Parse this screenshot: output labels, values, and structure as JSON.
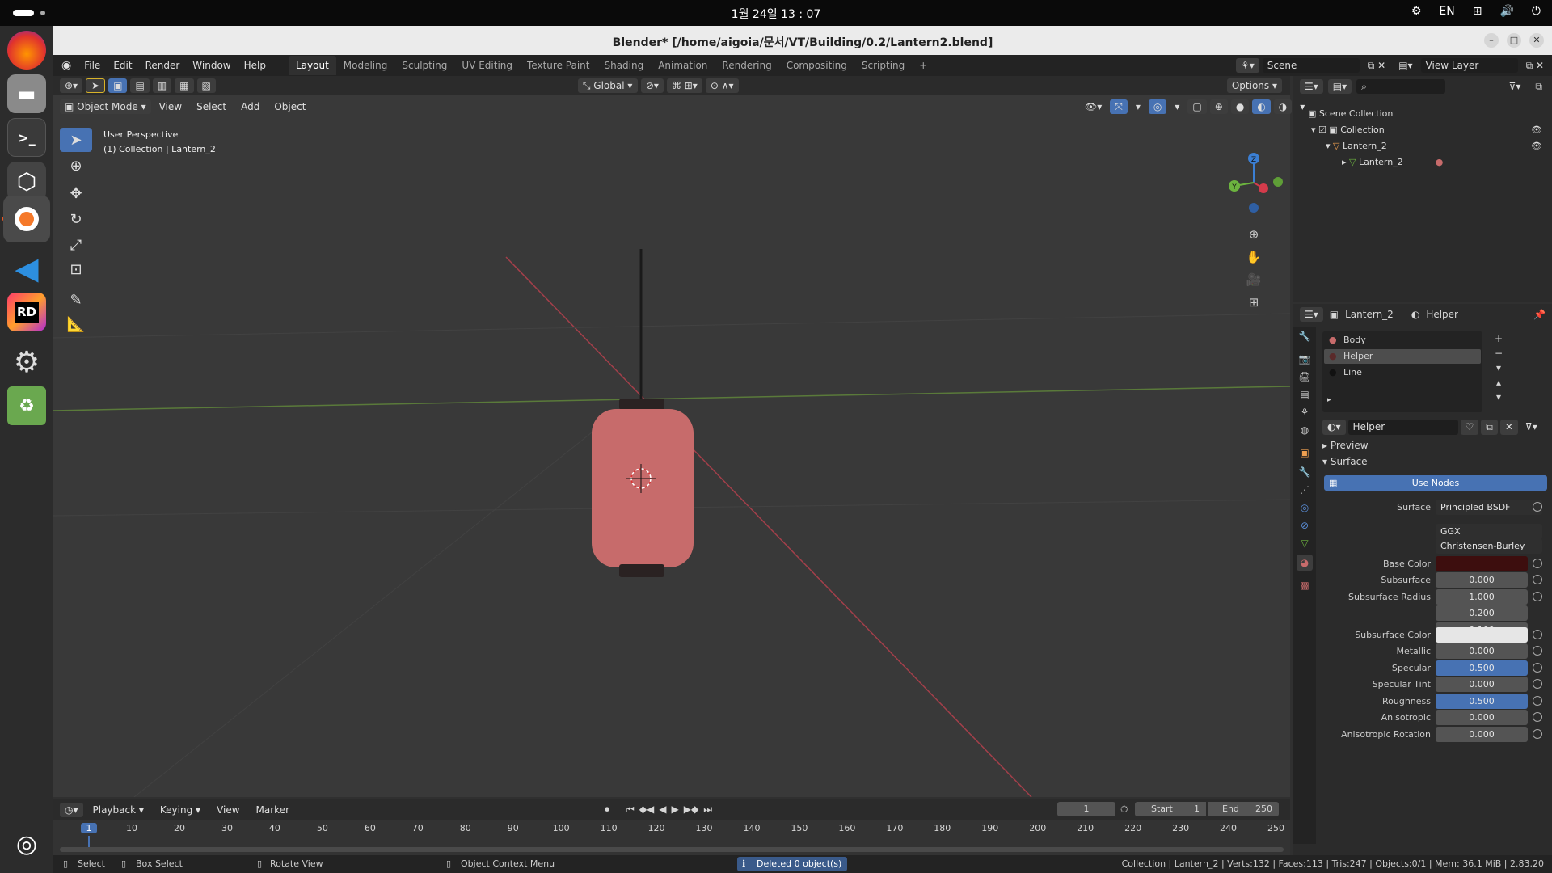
{
  "system": {
    "clock": "1월 24일  13 : 07",
    "lang": "EN"
  },
  "window": {
    "title": "Blender* [/home/aigoia/문서/VT/Building/0.2/Lantern2.blend]"
  },
  "menu": [
    "File",
    "Edit",
    "Render",
    "Window",
    "Help"
  ],
  "workspaces": [
    "Layout",
    "Modeling",
    "Sculpting",
    "UV Editing",
    "Texture Paint",
    "Shading",
    "Animation",
    "Rendering",
    "Compositing",
    "Scripting"
  ],
  "scene": {
    "label": "Scene",
    "view_layer": "View Layer"
  },
  "viewport": {
    "transform": "Global",
    "options": "Options",
    "mode": "Object Mode",
    "menus": [
      "View",
      "Select",
      "Add",
      "Object"
    ],
    "overlay_title": "User Perspective",
    "overlay_sub": "(1) Collection | Lantern_2",
    "gizmo": {
      "x": "X",
      "y": "Y",
      "z": "Z"
    }
  },
  "outliner": {
    "scene_collection": "Scene Collection",
    "collection": "Collection",
    "object": "Lantern_2",
    "mesh": "Lantern_2"
  },
  "properties": {
    "object": "Lantern_2",
    "material": "Helper",
    "slots": [
      "Body",
      "Helper",
      "Line"
    ],
    "active_slot": 1,
    "material_name": "Helper",
    "preview": "Preview",
    "surface_panel": "Surface",
    "use_nodes": "Use Nodes",
    "surface_label": "Surface",
    "surface_value": "Principled BSDF",
    "distribution": "GGX",
    "subsurface_method": "Christensen-Burley",
    "base_color_label": "Base Color",
    "base_color": "#3d0e0e",
    "rows": [
      {
        "label": "Subsurface",
        "value": "0.000",
        "blue": false
      },
      {
        "label": "Subsurface Radius",
        "value": "1.000",
        "blue": false
      },
      {
        "label": "",
        "value": "0.200",
        "blue": false
      },
      {
        "label": "",
        "value": "0.100",
        "blue": false
      }
    ],
    "subsurface_color_label": "Subsurface Color",
    "subsurface_color": "#e6e6e6",
    "rows2": [
      {
        "label": "Metallic",
        "value": "0.000",
        "blue": false
      },
      {
        "label": "Specular",
        "value": "0.500",
        "blue": true
      },
      {
        "label": "Specular Tint",
        "value": "0.000",
        "blue": false
      },
      {
        "label": "Roughness",
        "value": "0.500",
        "blue": true
      },
      {
        "label": "Anisotropic",
        "value": "0.000",
        "blue": false
      },
      {
        "label": "Anisotropic Rotation",
        "value": "0.000",
        "blue": false
      }
    ]
  },
  "timeline": {
    "menus": [
      "Playback",
      "Keying",
      "View",
      "Marker"
    ],
    "current": "1",
    "start_label": "Start",
    "start": "1",
    "end_label": "End",
    "end": "250",
    "ticks": [
      "1",
      "10",
      "20",
      "30",
      "40",
      "50",
      "60",
      "70",
      "80",
      "90",
      "100",
      "110",
      "120",
      "130",
      "140",
      "150",
      "160",
      "170",
      "180",
      "190",
      "200",
      "210",
      "220",
      "230",
      "240",
      "250"
    ]
  },
  "status": {
    "select": "Select",
    "box_select": "Box Select",
    "rotate": "Rotate View",
    "context": "Object Context Menu",
    "message": "Deleted 0 object(s)",
    "stats": "Collection | Lantern_2 | Verts:132 | Faces:113 | Tris:247 | Objects:0/1 | Mem: 36.1 MiB | 2.83.20"
  }
}
